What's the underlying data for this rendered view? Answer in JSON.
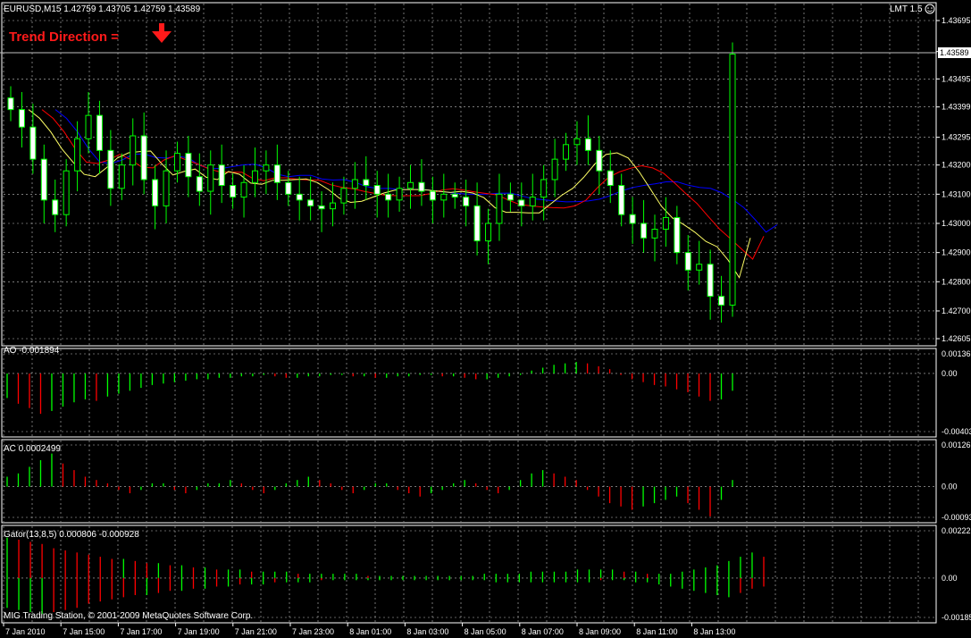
{
  "header": {
    "symbol_info": "EURUSD,M15  1.42759 1.43705 1.42759 1.43589",
    "trend_label": "Trend Direction =",
    "trend_arrow": "down-arrow-icon",
    "lmt": "LMT 1.5",
    "smiley": "smiley-icon"
  },
  "footer": {
    "copyright": "MIG Trading Station, © 2001-2009 MetaQuotes Software Corp."
  },
  "colors": {
    "bull": "#00ff00",
    "bear": "#ff0000",
    "grid": "#c0c0c0",
    "blue_line": "#0000ff",
    "red_line": "#ff0000",
    "yellow_line": "#ffff66"
  },
  "chart_data": [
    {
      "type": "candlestick",
      "title": "EURUSD,M15  1.42759 1.43705 1.42759 1.43589",
      "y_ticks": [
        "1.43695",
        "1.43589",
        "1.43495",
        "1.43399",
        "1.43295",
        "1.43200",
        "1.43100",
        "1.43000",
        "1.42900",
        "1.42800",
        "1.42700",
        "1.42605"
      ],
      "current_price": "1.43589",
      "x_ticks": [
        "7 Jan 2010",
        "7 Jan 15:00",
        "7 Jan 17:00",
        "7 Jan 19:00",
        "7 Jan 21:00",
        "7 Jan 23:00",
        "8 Jan 01:00",
        "8 Jan 03:00",
        "8 Jan 05:00",
        "8 Jan 07:00",
        "8 Jan 09:00",
        "8 Jan 11:00",
        "8 Jan 13:00"
      ],
      "ylim": [
        1.42605,
        1.43695
      ],
      "overlays": [
        "blue moving average",
        "red moving average",
        "yellow moving average"
      ],
      "closes": [
        1.4339,
        1.4333,
        1.4322,
        1.4308,
        1.4303,
        1.4318,
        1.4329,
        1.4337,
        1.4325,
        1.4312,
        1.432,
        1.433,
        1.4315,
        1.4306,
        1.4318,
        1.4324,
        1.4316,
        1.4311,
        1.432,
        1.4313,
        1.4309,
        1.4314,
        1.4318,
        1.432,
        1.4314,
        1.431,
        1.4308,
        1.4306,
        1.4305,
        1.4307,
        1.4312,
        1.4315,
        1.4313,
        1.431,
        1.4308,
        1.4312,
        1.4314,
        1.4311,
        1.4308,
        1.431,
        1.4309,
        1.4306,
        1.4294,
        1.43,
        1.431,
        1.4308,
        1.4306,
        1.4309,
        1.4315,
        1.4322,
        1.4327,
        1.4329,
        1.4325,
        1.4318,
        1.4313,
        1.4303,
        1.43,
        1.4295,
        1.4298,
        1.4302,
        1.429,
        1.4284,
        1.4286,
        1.4275,
        1.4272,
        1.4358
      ]
    },
    {
      "type": "bar",
      "title": "AO -0.001894",
      "y_ticks": [
        "0.00136",
        "0.00",
        "-0.00403"
      ],
      "ylim": [
        -0.00403,
        0.00136
      ],
      "values": [
        -0.0017,
        -0.0021,
        -0.0024,
        -0.0028,
        -0.0026,
        -0.0023,
        -0.002,
        -0.0018,
        -0.0019,
        -0.0016,
        -0.0014,
        -0.0012,
        -0.001,
        -0.0008,
        -0.0007,
        -0.0006,
        -0.0005,
        -0.0004,
        -0.0004,
        -0.0003,
        -0.0003,
        -0.0002,
        -0.0002,
        -0.0001,
        -0.0002,
        -0.0003,
        -0.0003,
        -0.0002,
        -0.0002,
        -0.0001,
        -0.0001,
        -0.0002,
        -0.0002,
        -0.0003,
        -0.0003,
        -0.0002,
        -0.0002,
        -0.0001,
        -0.0001,
        -0.0002,
        -0.0002,
        -0.0003,
        -0.0004,
        -0.0004,
        -0.0003,
        -0.0002,
        -0.0001,
        0.0002,
        0.0004,
        0.0006,
        0.0007,
        0.0008,
        0.0007,
        0.0005,
        0.0003,
        -0.0001,
        -0.0004,
        -0.0006,
        -0.0008,
        -0.0009,
        -0.0011,
        -0.0013,
        -0.0016,
        -0.0019,
        -0.0018,
        -0.0012
      ]
    },
    {
      "type": "bar",
      "title": "AC 0.0002499",
      "y_ticks": [
        "0.00126",
        "0.00",
        "-0.00093"
      ],
      "ylim": [
        -0.00093,
        0.00126
      ],
      "values": [
        0.0003,
        0.0004,
        0.0006,
        0.0008,
        0.001,
        0.0007,
        0.0005,
        0.0003,
        0.0002,
        0.0001,
        -0.0001,
        -0.0002,
        -0.0001,
        0.0001,
        0.0001,
        -0.0001,
        -0.0002,
        -0.0001,
        0.0001,
        0.0001,
        0.0002,
        0.0001,
        -0.0001,
        -0.0002,
        -0.0001,
        0.0001,
        0.0002,
        0.0003,
        0.0002,
        0.0001,
        -0.0001,
        -0.0002,
        -0.0001,
        0.0001,
        0.0001,
        -0.0001,
        -0.0002,
        -0.0003,
        -0.0002,
        -0.0001,
        0.0001,
        0.0002,
        0.0001,
        -0.0001,
        -0.0002,
        -0.0001,
        0.0002,
        0.0004,
        0.0005,
        0.0004,
        0.0003,
        0.0002,
        -0.0001,
        -0.0003,
        -0.0005,
        -0.0006,
        -0.0007,
        -0.0006,
        -0.0005,
        -0.0004,
        -0.0003,
        -0.0005,
        -0.0007,
        -0.0009,
        -0.0004,
        0.0002
      ]
    },
    {
      "type": "bar",
      "title": "Gator(13,8,5) 0.000806 -0.000928",
      "y_ticks": [
        "0.00222",
        "0.00",
        "-0.00185"
      ],
      "ylim": [
        -0.00185,
        0.00222
      ],
      "upper": [
        0.0019,
        0.0018,
        0.0017,
        0.0016,
        0.0014,
        0.0013,
        0.0012,
        0.0011,
        0.001,
        0.0009,
        0.0009,
        0.0008,
        0.0007,
        0.0007,
        0.0006,
        0.0006,
        0.0005,
        0.0005,
        0.0004,
        0.0004,
        0.0004,
        0.0003,
        0.0003,
        0.0003,
        0.0003,
        0.0002,
        0.0002,
        0.0002,
        0.0002,
        0.0002,
        0.0002,
        0.0001,
        0.0001,
        0.0001,
        0.0001,
        0.0001,
        0.0001,
        0.0001,
        0.0001,
        0.0001,
        0.0001,
        0.0002,
        0.0002,
        0.0002,
        0.0002,
        0.0003,
        0.0003,
        0.0003,
        0.0003,
        0.0004,
        0.0004,
        0.0004,
        0.0004,
        0.0003,
        0.0003,
        0.0002,
        0.0002,
        0.0002,
        0.0003,
        0.0004,
        0.0005,
        0.0006,
        0.0008,
        0.001,
        0.0012,
        0.001
      ],
      "lower": [
        -0.0014,
        -0.0015,
        -0.0016,
        -0.0017,
        -0.0016,
        -0.0015,
        -0.0014,
        -0.0012,
        -0.0011,
        -0.001,
        -0.0009,
        -0.0008,
        -0.0008,
        -0.0007,
        -0.0006,
        -0.0006,
        -0.0005,
        -0.0005,
        -0.0004,
        -0.0004,
        -0.0003,
        -0.0003,
        -0.0003,
        -0.0002,
        -0.0002,
        -0.0002,
        -0.0002,
        -0.0001,
        -0.0001,
        -0.0001,
        -0.0001,
        -0.0001,
        -0.0001,
        -0.0001,
        -0.0001,
        -0.0001,
        -0.0001,
        -0.0001,
        -0.0001,
        -0.0001,
        -0.0001,
        -0.0001,
        -0.0002,
        -0.0002,
        -0.0002,
        -0.0002,
        -0.0002,
        -0.0002,
        -0.0002,
        -0.0002,
        -0.0002,
        -0.0001,
        -0.0001,
        -0.0001,
        -0.0002,
        -0.0002,
        -0.0003,
        -0.0004,
        -0.0005,
        -0.0006,
        -0.0007,
        -0.0008,
        -0.0009,
        -0.0007,
        -0.0005,
        -0.0004
      ]
    }
  ]
}
